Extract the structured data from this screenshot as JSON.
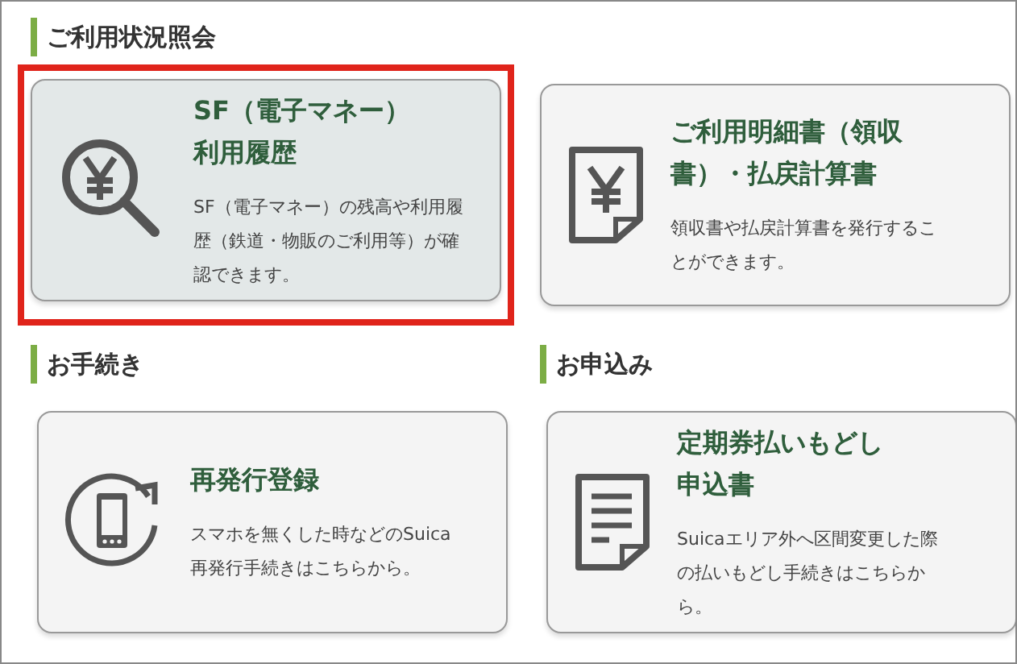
{
  "sections": [
    {
      "title": "ご利用状況照会",
      "cards": [
        {
          "title": "SF（電子マネー）利用履歴",
          "description": "SF（電子マネー）の残高や利用履歴（鉄道・物販のご利用等）が確認できます。",
          "selected": true
        },
        {
          "title": "ご利用明細書（領収書）・払戻計算書",
          "description": "領収書や払戻計算書を発行することができます。",
          "selected": false
        }
      ]
    },
    {
      "title": "お手続き",
      "cards": [
        {
          "title": "再発行登録",
          "description": "スマホを無くした時などのSuica再発行手続きはこちらから。",
          "selected": false
        }
      ]
    },
    {
      "title": "お申込み",
      "cards": [
        {
          "title": "定期券払いもどし申込書",
          "description": "Suicaエリア外へ区間変更した際の払いもどし手続きはこちらから。",
          "selected": false
        }
      ]
    }
  ]
}
